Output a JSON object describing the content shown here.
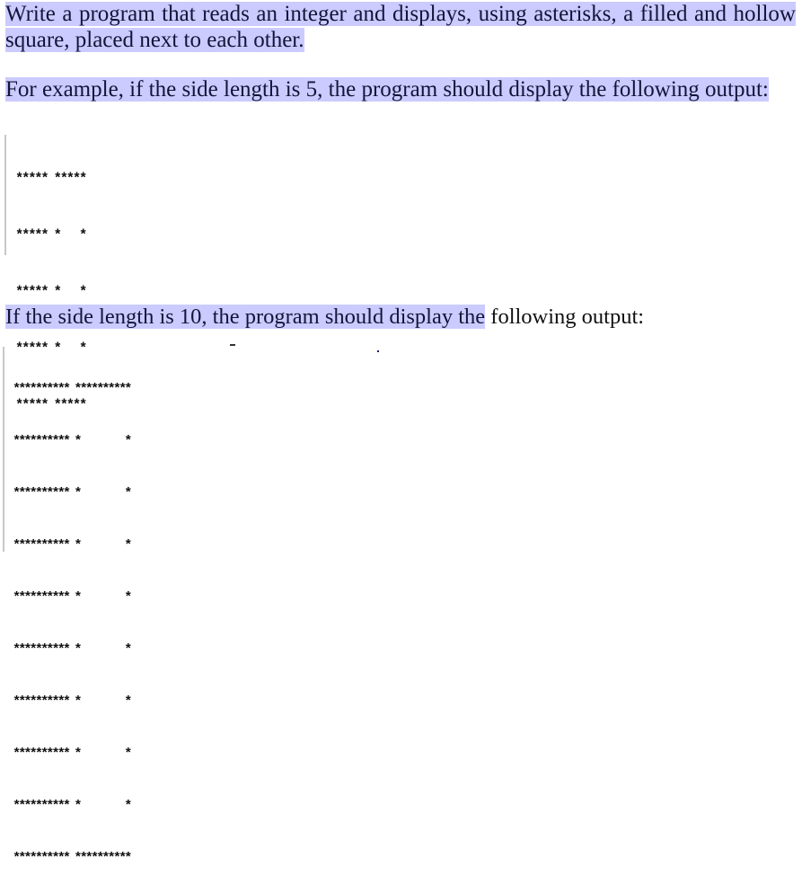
{
  "paragraphs": {
    "intro": "Write a program that reads an integer and displays, using asterisks, a filled and hollow square, placed next to each other.",
    "example_5": "For example, if the side length is 5, the program should display the following output:",
    "example_10_highlighted": "If the side length is 10, the program should display the",
    "example_10_rest": " following output:"
  },
  "outputs": {
    "size_5": {
      "side_length": 5,
      "rows": [
        "***** *****",
        "***** *   *",
        "***** *   *",
        "***** *   *",
        "***** *****"
      ]
    },
    "size_10": {
      "side_length": 10,
      "rows": [
        "********** **********",
        "********** *        *",
        "********** *        *",
        "********** *        *",
        "********** *        *",
        "********** *        *",
        "********** *        *",
        "********** *        *",
        "********** *        *",
        "********** **********"
      ]
    }
  },
  "colors": {
    "highlight": "#cbcbff",
    "text": "#14143a"
  }
}
